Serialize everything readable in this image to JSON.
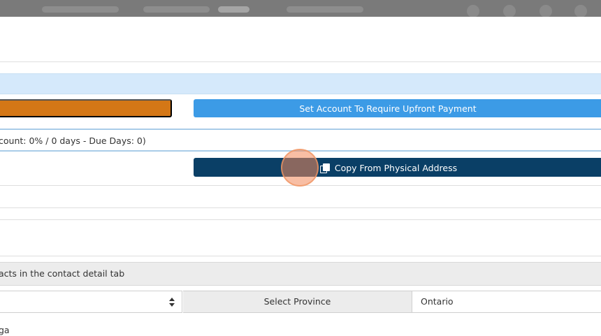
{
  "header": {
    "icons": [
      "user-icon",
      "settings-icon",
      "bell-icon",
      "grid-icon"
    ]
  },
  "account": {
    "orange_button_label": "",
    "upfront_button_label": "Set Account To Require Upfront Payment",
    "terms_text": "count: 0% / 0 days - Due Days: 0)"
  },
  "address": {
    "copy_button_label": "Copy From Physical Address",
    "copy_icon": "copy-icon"
  },
  "contacts": {
    "note_text": "acts in the contact detail tab"
  },
  "location": {
    "province_label": "Select Province",
    "province_value": "Ontario",
    "city_text": "ga"
  },
  "colors": {
    "upfront_button": "#3c9be6",
    "orange_button": "#d47716",
    "copy_button": "#0a3f66",
    "info_bar": "#d5e9fb"
  }
}
